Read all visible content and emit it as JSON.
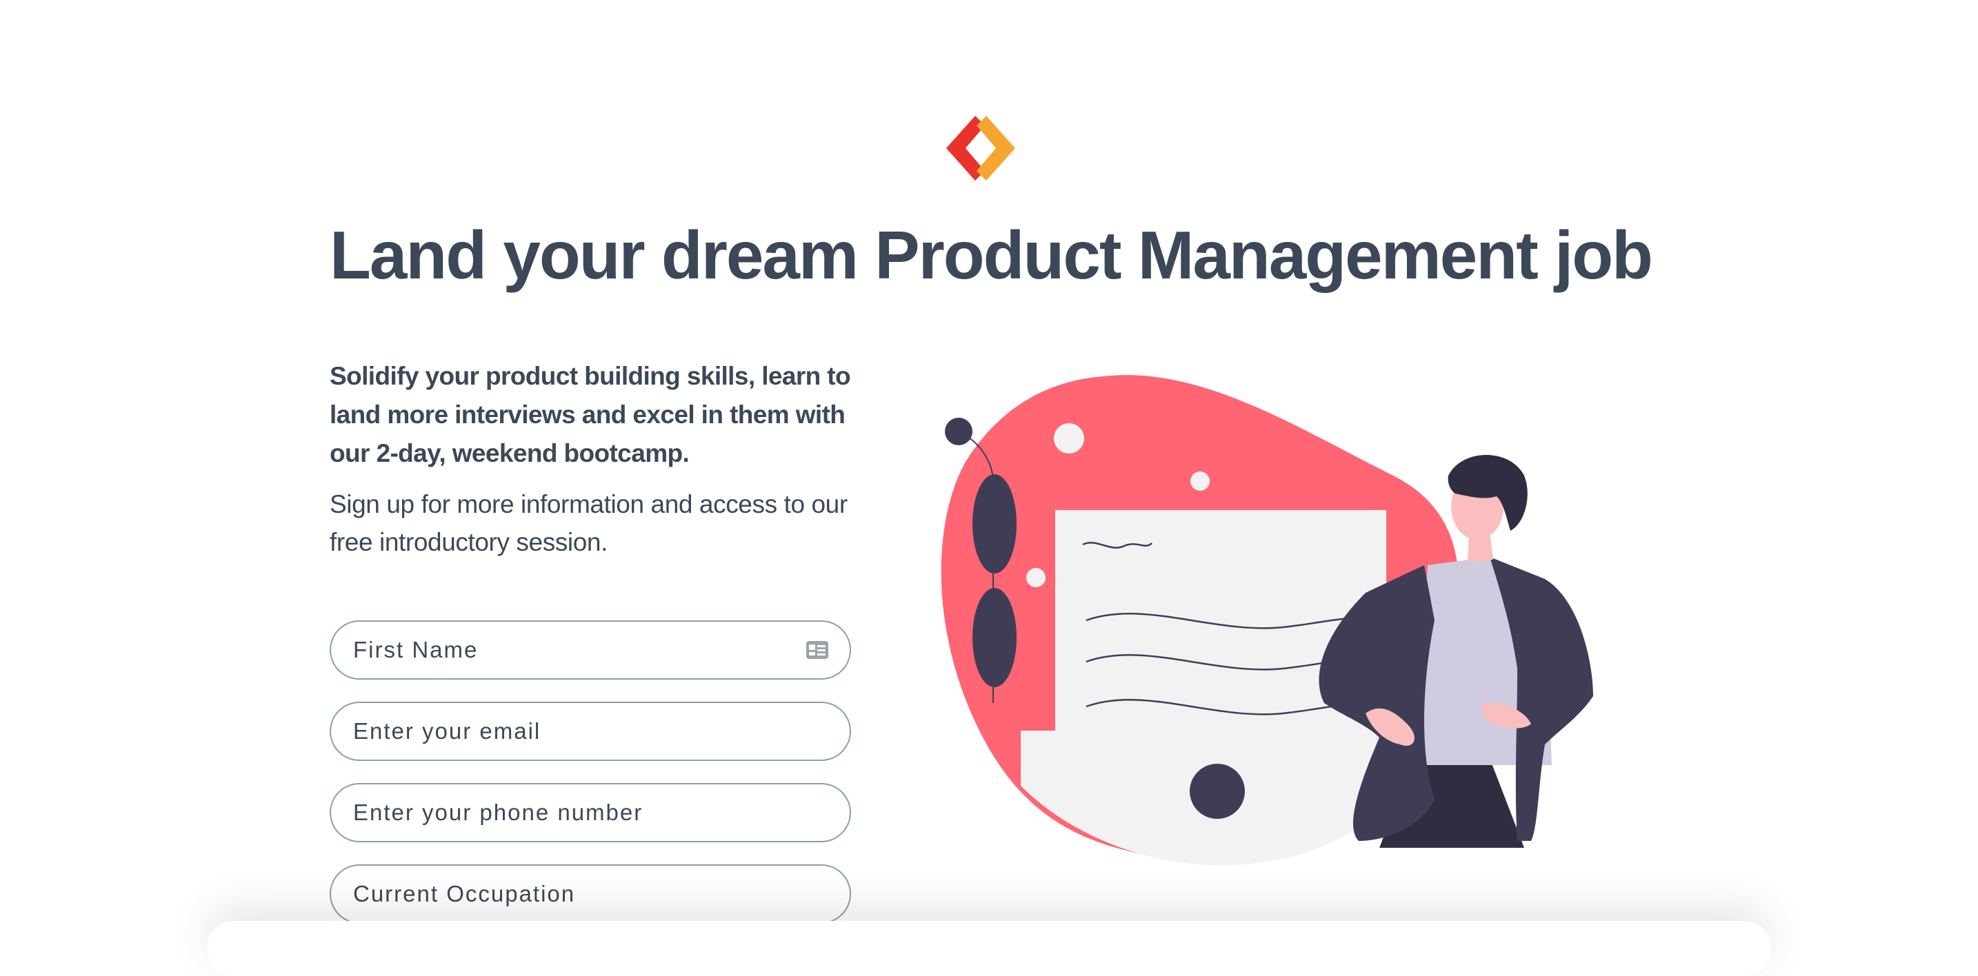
{
  "hero": {
    "headline": "Land your dream Product Management job",
    "lead": "Solidify your product building skills,  learn to land more interviews and excel in them with our 2-day, weekend bootcamp.",
    "sub": "Sign up for more information and access to our free introductory session."
  },
  "form": {
    "first_name_placeholder": "First Name",
    "email_placeholder": "Enter your email",
    "phone_placeholder": "Enter your phone number",
    "occupation_placeholder": "Current Occupation"
  },
  "icons": {
    "logo": "brand-chevrons-icon",
    "contact_card": "contact-card-icon"
  },
  "colors": {
    "logo_red": "#e8322b",
    "logo_orange": "#f7a531",
    "text": "#3c4858",
    "blob": "#ff6573",
    "paper": "#f2f2f2",
    "dark": "#3f3d56",
    "shirt": "#cfcce0",
    "skin": "#fbbebe"
  }
}
